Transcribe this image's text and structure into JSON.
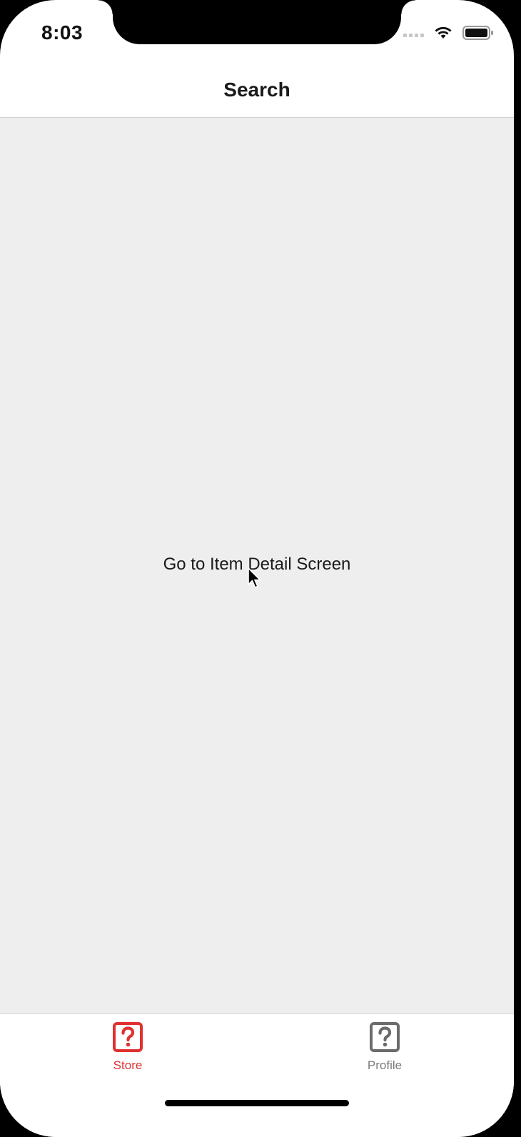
{
  "status_bar": {
    "time": "8:03"
  },
  "nav": {
    "title": "Search"
  },
  "content": {
    "button_label": "Go to Item Detail Screen"
  },
  "tabs": [
    {
      "label": "Store",
      "icon": "question-mark-box-icon",
      "active": true,
      "color": "#e03131"
    },
    {
      "label": "Profile",
      "icon": "question-mark-box-icon",
      "active": false,
      "color": "#7a7a7a"
    }
  ],
  "colors": {
    "accent": "#e03131",
    "inactive": "#7a7a7a",
    "content_background": "#eeeeee"
  }
}
